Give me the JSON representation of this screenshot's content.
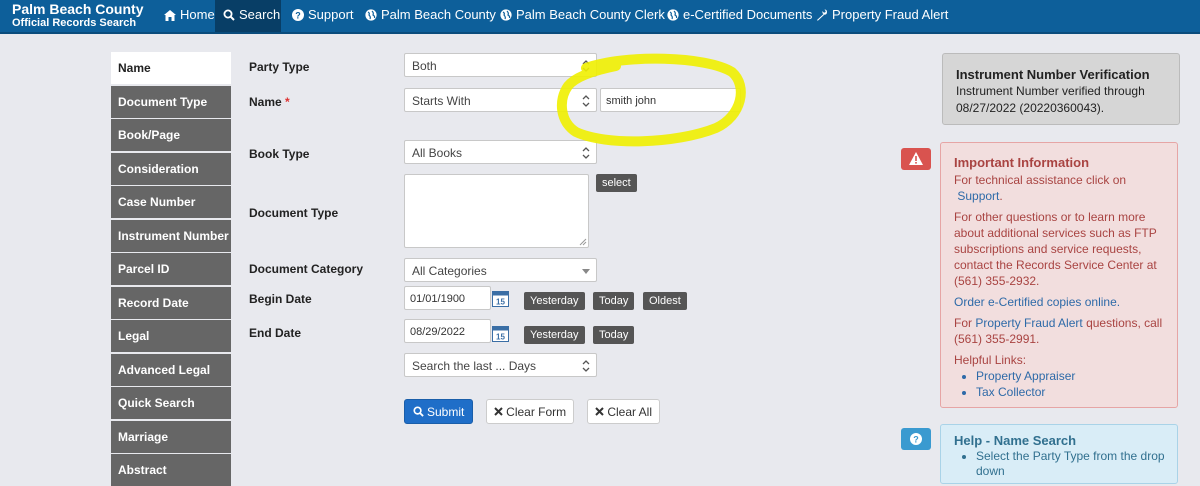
{
  "brand": {
    "line1": "Palm Beach County",
    "line2": "Official Records Search"
  },
  "nav": {
    "home": "Home",
    "search": "Search",
    "support": "Support",
    "pbc": "Palm Beach County",
    "pbc_clerk": "Palm Beach County Clerk",
    "ecert": "e-Certified Documents",
    "fraud": "Property Fraud Alert"
  },
  "sidebar": {
    "items": [
      {
        "label": "Name"
      },
      {
        "label": "Document Type"
      },
      {
        "label": "Book/Page"
      },
      {
        "label": "Consideration"
      },
      {
        "label": "Case Number"
      },
      {
        "label": "Instrument Number"
      },
      {
        "label": "Parcel ID"
      },
      {
        "label": "Record Date"
      },
      {
        "label": "Legal"
      },
      {
        "label": "Advanced Legal"
      },
      {
        "label": "Quick Search"
      },
      {
        "label": "Marriage"
      },
      {
        "label": "Abstract"
      }
    ]
  },
  "form": {
    "party_type_label": "Party Type",
    "party_type_value": "Both",
    "name_label": "Name",
    "name_required": "*",
    "name_match_value": "Starts With",
    "name_value": "smith john",
    "book_type_label": "Book Type",
    "book_type_value": "All Books",
    "document_type_label": "Document Type",
    "select_label": "select",
    "document_category_label": "Document Category",
    "document_category_value": "All Categories",
    "begin_date_label": "Begin Date",
    "begin_date_value": "01/01/1900",
    "end_date_label": "End Date",
    "end_date_value": "08/29/2022",
    "calendar_day": "15",
    "yesterday": "Yesterday",
    "today": "Today",
    "oldest": "Oldest",
    "last_days_value": "Search the last ... Days",
    "submit": "Submit",
    "clear_form": "Clear Form",
    "clear_all": "Clear All"
  },
  "verify": {
    "title": "Instrument Number Verification",
    "line1": "Instrument Number verified through",
    "line2": "08/27/2022 (20220360043)."
  },
  "info": {
    "title": "Important Information",
    "p1a": "For technical assistance click on",
    "p1_link": "Support",
    "p1b": ".",
    "p2": "For other questions or to learn more about additional services such as FTP subscriptions and service requests, contact the Records Service Center at (561) 355-2932.",
    "p3_link": "Order e-Certified copies online.",
    "p4a": "For",
    "p4_link": "Property Fraud Alert",
    "p4b": "questions, call (561) 355-2991.",
    "helpful": "Helpful Links:",
    "link1": "Property Appraiser",
    "link2": "Tax Collector"
  },
  "help": {
    "title": "Help - Name Search",
    "item1": "Select the Party Type from the drop down"
  },
  "colors": {
    "navbar": "#0d5f9a",
    "highlight": "#f0ef00",
    "primary": "#1f6ec8"
  }
}
